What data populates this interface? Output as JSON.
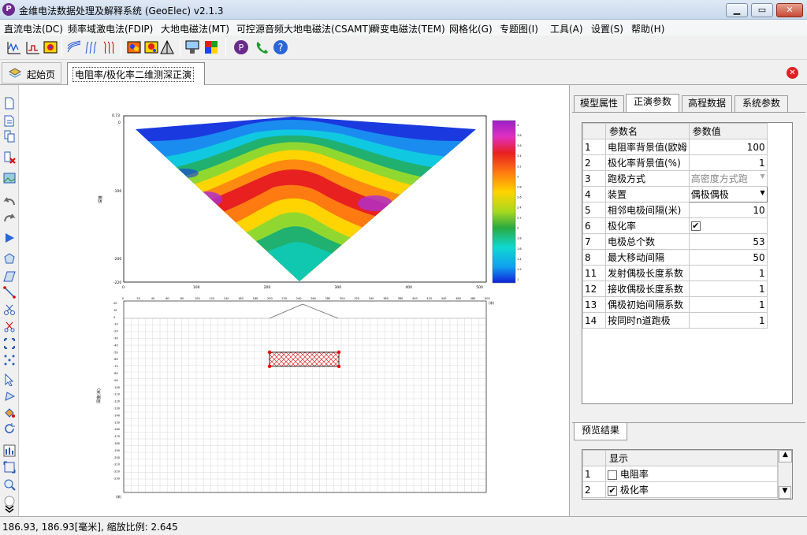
{
  "window": {
    "title": "金维电法数据处理及解释系统 (GeoElec)  v2.1.3",
    "logo": "P"
  },
  "menu": [
    "直流电法(DC)",
    "频率域激电法(FDIP)",
    "大地电磁法(MT)",
    "可控源音频大地电磁法(CSAMT)",
    "瞬变电磁法(TEM)",
    "网格化(G)",
    "专题图(I)",
    "工具(A)",
    "设置(S)",
    "帮助(H)"
  ],
  "tabs": {
    "home": "起始页",
    "active": "电阻率/极化率二维测深正演"
  },
  "right_tabs": [
    "模型属性",
    "正演参数",
    "高程数据",
    "系统参数"
  ],
  "params": {
    "headers": [
      "参数名",
      "参数值"
    ],
    "rows": [
      {
        "n": "1",
        "name": "电阻率背景值(欧姆",
        "value": "100"
      },
      {
        "n": "2",
        "name": "极化率背景值(%)",
        "value": "1"
      },
      {
        "n": "3",
        "name": "跑极方式",
        "value": "高密度方式跑"
      },
      {
        "n": "4",
        "name": "装置",
        "value": "偶极偶极"
      },
      {
        "n": "5",
        "name": "相邻电极间隔(米)",
        "value": "10"
      },
      {
        "n": "6",
        "name": "极化率",
        "value": "✔"
      },
      {
        "n": "7",
        "name": "电极总个数",
        "value": "53"
      },
      {
        "n": "8",
        "name": "最大移动间隔",
        "value": "50"
      },
      {
        "n": "11",
        "name": "发射偶极长度系数",
        "value": "1"
      },
      {
        "n": "12",
        "name": "接收偶极长度系数",
        "value": "1"
      },
      {
        "n": "13",
        "name": "偶极初始间隔系数",
        "value": "1"
      },
      {
        "n": "14",
        "name": "按同时n道跑极",
        "value": "1"
      }
    ]
  },
  "preview": {
    "tab": "预览结果",
    "header": "显示",
    "rows": [
      {
        "n": "1",
        "label": "电阻率",
        "checked": ""
      },
      {
        "n": "2",
        "label": "极化率",
        "checked": "✔"
      }
    ]
  },
  "plot": {
    "left_top": "0.73",
    "left_zero": "0",
    "left_mid": "-100",
    "left_low": "-200",
    "left_bot": "-220",
    "xticks": [
      "0",
      "100",
      "200",
      "300",
      "400",
      "500"
    ],
    "ylabel": "深度",
    "colorbar": [
      "4",
      "3.8",
      "3.6",
      "3.4",
      "3.2",
      "3",
      "2.8",
      "2.6",
      "2.4",
      "2.2",
      "2",
      "1.8",
      "1.6",
      "1.4",
      "1.2",
      "1"
    ]
  },
  "model": {
    "xticks": [
      "0",
      "20",
      "40",
      "60",
      "80",
      "100",
      "120",
      "140",
      "160",
      "180",
      "200",
      "220",
      "240",
      "260",
      "280",
      "300",
      "320",
      "340",
      "360",
      "380",
      "400",
      "420",
      "440",
      "460",
      "480",
      "500"
    ],
    "xunit": "(米)",
    "yticks": [
      "20",
      "10",
      "0",
      "-10",
      "-20",
      "-30",
      "-40",
      "-50",
      "-60",
      "-70",
      "-80",
      "-90",
      "-100",
      "-110",
      "-120",
      "-130",
      "-140",
      "-150",
      "-160",
      "-170",
      "-180",
      "-190",
      "-200",
      "-210",
      "-220",
      "-230"
    ],
    "ylabel": "深度(米)",
    "yunit": "(米)"
  },
  "status": "186.93, 186.93[毫米], 缩放比例: 2.645"
}
